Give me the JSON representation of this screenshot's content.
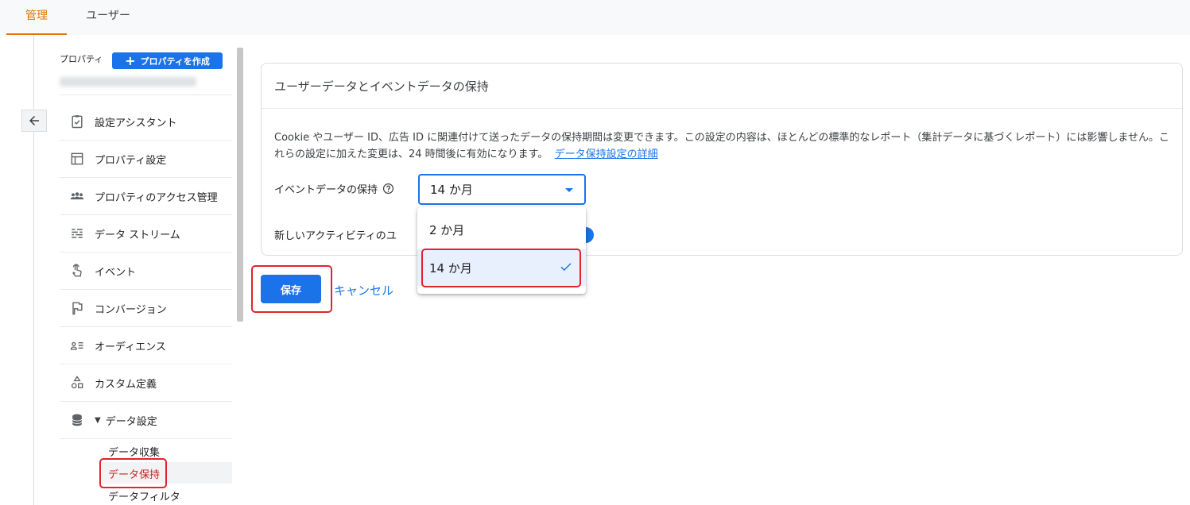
{
  "tabs": [
    {
      "label": "管理",
      "active": true
    },
    {
      "label": "ユーザー",
      "active": false
    }
  ],
  "sidebar": {
    "property_label": "プロパティ",
    "create_property_label": "プロパティを作成",
    "items": [
      {
        "label": "設定アシスタント",
        "icon": "clipboard-check-icon"
      },
      {
        "label": "プロパティ設定",
        "icon": "layout-icon"
      },
      {
        "label": "プロパティのアクセス管理",
        "icon": "people-icon"
      },
      {
        "label": "データ ストリーム",
        "icon": "streams-icon"
      },
      {
        "label": "イベント",
        "icon": "touch-icon"
      },
      {
        "label": "コンバージョン",
        "icon": "flag-icon"
      },
      {
        "label": "オーディエンス",
        "icon": "audience-icon"
      },
      {
        "label": "カスタム定義",
        "icon": "shapes-icon"
      },
      {
        "label": "データ設定",
        "icon": "database-icon",
        "expanded": true
      }
    ],
    "sub_items": [
      {
        "label": "データ収集"
      },
      {
        "label": "データ保持",
        "active": true
      },
      {
        "label": "データフィルタ"
      }
    ]
  },
  "card": {
    "title": "ユーザーデータとイベントデータの保持",
    "description": "Cookie やユーザー ID、広告 ID に関連付けて送ったデータの保持期間は変更できます。この設定の内容は、ほとんどの標準的なレポート（集計データに基づくレポート）には影響しません。これらの設定に加えた変更は、24 時間後に有効になります。",
    "learn_more_link": "データ保持設定の詳細",
    "event_retention_label": "イベントデータの保持",
    "event_retention_value": "14 か月",
    "new_activity_label": "新しいアクティビティのユ",
    "new_activity_enabled": true
  },
  "dropdown": {
    "options": [
      {
        "label": "2 か月",
        "selected": false
      },
      {
        "label": "14 か月",
        "selected": true
      }
    ]
  },
  "actions": {
    "save_label": "保存",
    "cancel_label": "キャンセル"
  },
  "colors": {
    "accent": "#1a73e8",
    "active_tab": "#e37400",
    "annotation_red": "#e0242a"
  }
}
